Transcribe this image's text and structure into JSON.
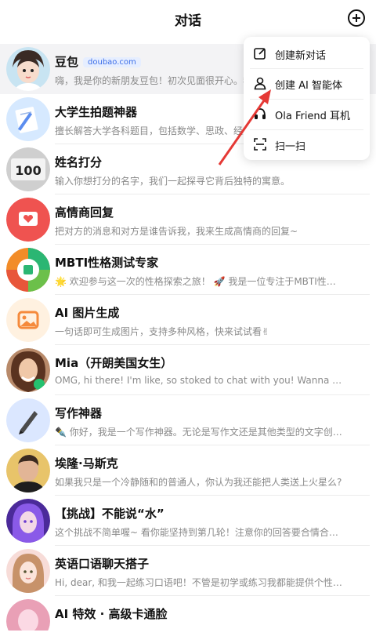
{
  "header": {
    "title": "对话"
  },
  "menu": {
    "items": [
      {
        "label": "创建新对话",
        "icon": "edit-icon"
      },
      {
        "label": "创建 AI 智能体",
        "icon": "user-icon"
      },
      {
        "label": "Ola Friend 耳机",
        "icon": "headphone-icon"
      },
      {
        "label": "扫一扫",
        "icon": "scan-icon"
      }
    ]
  },
  "conversations": [
    {
      "name": "豆包",
      "tag": "doubao.com",
      "preview": "嗨，我是你的新朋友豆包！初次见面很开心。我",
      "avatar_color": "#f0d7ce"
    },
    {
      "name": "大学生拍题神器",
      "preview": "擅长解答大学各科题目，包括数学、思政、经济",
      "avatar_color": "#d6e9ff"
    },
    {
      "name": "姓名打分",
      "preview": "输入你想打分的名字，我们一起探寻它背后独特的寓意。",
      "avatar_color": "#d8d8d8"
    },
    {
      "name": "高情商回复",
      "preview": "把对方的消息和对方是谁告诉我，我来生成高情商的回复~",
      "avatar_color": "#ef5350"
    },
    {
      "name": "MBTI性格测试专家",
      "preview": "🌟 欢迎参与这一次的性格探索之旅！ 🚀 我是一位专注于MBTI性格类型...",
      "avatar_color": "#f28c28"
    },
    {
      "name": "AI 图片生成",
      "preview": "一句话即可生成图片，支持多种风格，快来试试看✌",
      "avatar_color": "#fff1e0"
    },
    {
      "name": "Mia（开朗美国女生）",
      "preview": "OMG, hi there! I'm like, so stoked to chat with you! Wanna practice some...",
      "avatar_color": "#c79a7a"
    },
    {
      "name": "写作神器",
      "preview": "✒️ 你好，我是一个写作神器。无论是写作文还是其他类型的文字创作，...",
      "avatar_color": "#dbe7ff"
    },
    {
      "name": "埃隆·马斯克",
      "preview": "如果我只是一个冷静随和的普通人，你认为我还能把人类送上火星么?",
      "avatar_color": "#e8c46a"
    },
    {
      "name": "【挑战】不能说“水”",
      "preview": "这个挑战不简单喔~ 看你能坚持到第几轮！注意你的回答要合情合理喔~ ...",
      "avatar_color": "#7b4ad8"
    },
    {
      "name": "英语口语聊天搭子",
      "preview": "Hi, dear, 和我一起练习口语吧！不管是初学或练习我都能提供个性化的学...",
      "avatar_color": "#f7dcd8"
    },
    {
      "name": "AI 特效 · 高级卡通脸",
      "preview": "",
      "avatar_color": "#e9a0b6"
    }
  ]
}
